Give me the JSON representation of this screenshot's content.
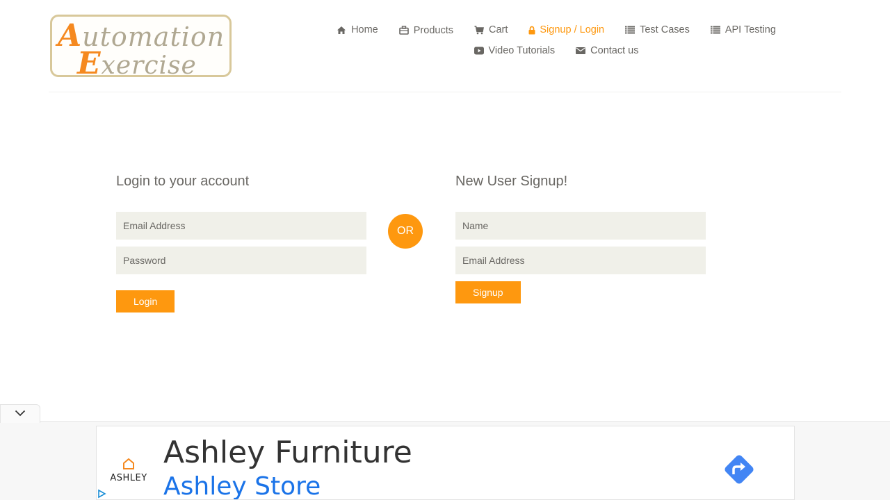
{
  "header": {
    "logo": {
      "line1": "Automation",
      "line2": "Exercise"
    },
    "nav": [
      {
        "label": "Home",
        "icon": "home-icon"
      },
      {
        "label": "Products",
        "icon": "briefcase-icon"
      },
      {
        "label": "Cart",
        "icon": "cart-icon"
      },
      {
        "label": "Signup / Login",
        "icon": "lock-icon",
        "active": true
      },
      {
        "label": "Test Cases",
        "icon": "list-icon"
      },
      {
        "label": "API Testing",
        "icon": "list-icon"
      },
      {
        "label": "Video Tutorials",
        "icon": "youtube-icon"
      },
      {
        "label": "Contact us",
        "icon": "envelope-icon"
      }
    ]
  },
  "login": {
    "title": "Login to your account",
    "email_placeholder": "Email Address",
    "password_placeholder": "Password",
    "button": "Login"
  },
  "or_label": "OR",
  "signup": {
    "title": "New User Signup!",
    "name_placeholder": "Name",
    "email_placeholder": "Email Address",
    "button": "Signup"
  },
  "ad": {
    "brand": "ASHLEY",
    "headline": "Ashley Furniture",
    "subheadline": "Ashley Store"
  },
  "colors": {
    "accent": "#fe980f",
    "text": "#696763",
    "field_bg": "#f0f0e9",
    "ad_blue": "#1a73e8"
  }
}
